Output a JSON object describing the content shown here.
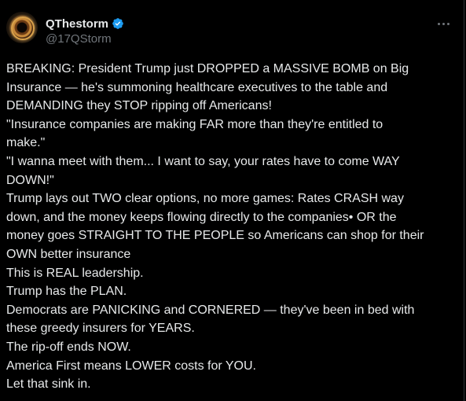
{
  "author": {
    "display_name": "QThestorm",
    "handle": "@17QStorm",
    "avatar_icon": "avatar-image",
    "verified_icon": "verified-badge-icon",
    "verified_color": "#1d9bf0"
  },
  "more_menu_icon": "more-horizontal-icon",
  "tweet": {
    "lines": [
      "BREAKING: President Trump just DROPPED a MASSIVE BOMB on Big",
      "Insurance — he's summoning healthcare executives to the table and",
      "DEMANDING they STOP ripping off Americans!",
      "\"Insurance companies are making FAR more than they're entitled to",
      "make.\"",
      "\"I wanna meet with them... I want to say, your rates have to come WAY",
      "DOWN!\"",
      "Trump lays out TWO clear options, no more games: Rates CRASH way",
      "down, and the money keeps flowing directly to the companies• OR the",
      "money goes STRAIGHT TO THE PEOPLE so Americans can shop for their",
      "OWN better insurance",
      "This is REAL leadership.",
      "Trump has the PLAN.",
      "Democrats are PANICKING and CORNERED — they've been in bed with",
      "these greedy insurers for YEARS.",
      "The rip-off ends NOW.",
      "America First means LOWER costs for YOU.",
      "Let that sink in."
    ]
  },
  "colors": {
    "background": "#000000",
    "text": "#e7e9ea",
    "secondary": "#71767b"
  }
}
